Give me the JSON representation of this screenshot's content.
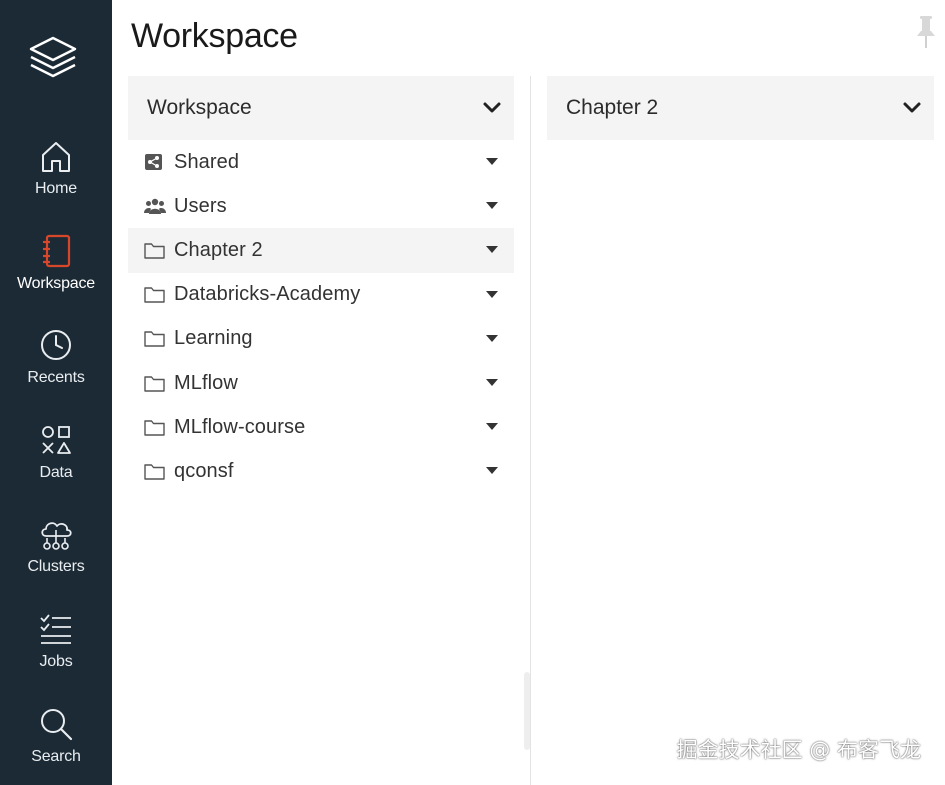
{
  "sidebar": {
    "logo": "stacked-layers-logo",
    "items": [
      {
        "label": "Home",
        "icon": "home-icon"
      },
      {
        "label": "Workspace",
        "icon": "workspace-icon",
        "active": true
      },
      {
        "label": "Recents",
        "icon": "clock-icon"
      },
      {
        "label": "Data",
        "icon": "data-shapes-icon"
      },
      {
        "label": "Clusters",
        "icon": "cloud-cluster-icon"
      },
      {
        "label": "Jobs",
        "icon": "checklist-icon"
      },
      {
        "label": "Search",
        "icon": "search-icon"
      }
    ],
    "accent_color": "#d9472b",
    "background": "#1b2a35"
  },
  "header": {
    "title": "Workspace",
    "pin_icon": "pin-icon"
  },
  "browser": {
    "column1": {
      "title": "Workspace",
      "items": [
        {
          "label": "Shared",
          "icon": "shared-icon"
        },
        {
          "label": "Users",
          "icon": "users-icon"
        },
        {
          "label": "Chapter 2",
          "icon": "folder-icon",
          "selected": true
        },
        {
          "label": "Databricks-Academy",
          "icon": "folder-icon"
        },
        {
          "label": "Learning",
          "icon": "folder-icon"
        },
        {
          "label": "MLflow",
          "icon": "folder-icon"
        },
        {
          "label": "MLflow-course",
          "icon": "folder-icon"
        },
        {
          "label": "qconsf",
          "icon": "folder-icon"
        }
      ]
    },
    "column2": {
      "title": "Chapter 2"
    }
  },
  "watermark": "掘金技术社区 @ 布客飞龙"
}
